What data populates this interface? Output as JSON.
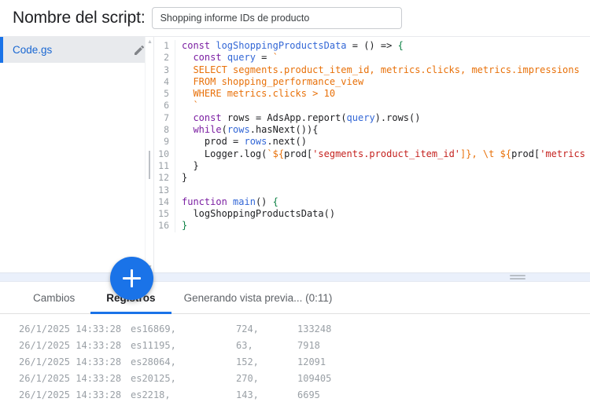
{
  "header": {
    "label": "Nombre del script:",
    "script_name": "Shopping informe IDs de producto",
    "placeholder": "Nombre del script"
  },
  "sidebar": {
    "files": [
      {
        "name": "Code.gs",
        "edit_icon": "pencil-icon",
        "active": true
      }
    ],
    "add_button_icon": "plus-icon",
    "scroll_up_icon": "caret-up-icon",
    "scroll_down_icon": "caret-down-icon"
  },
  "editor": {
    "lines": [
      {
        "n": "1",
        "tokens": [
          {
            "t": "const ",
            "c": "kw"
          },
          {
            "t": "logShoppingProductsData",
            "c": "fn"
          },
          {
            "t": " = () => ",
            "c": "plain"
          },
          {
            "t": "{",
            "c": "brc"
          }
        ]
      },
      {
        "n": "2",
        "tokens": [
          {
            "t": "  ",
            "c": "plain"
          },
          {
            "t": "const ",
            "c": "kw"
          },
          {
            "t": "query",
            "c": "var"
          },
          {
            "t": " = ",
            "c": "plain"
          },
          {
            "t": "`",
            "c": "sql"
          }
        ]
      },
      {
        "n": "3",
        "tokens": [
          {
            "t": "  SELECT segments.product_item_id, metrics.clicks, metrics.impressions",
            "c": "sql"
          }
        ]
      },
      {
        "n": "4",
        "tokens": [
          {
            "t": "  FROM shopping_performance_view",
            "c": "sql"
          }
        ]
      },
      {
        "n": "5",
        "tokens": [
          {
            "t": "  WHERE metrics.clicks > 10",
            "c": "sql"
          }
        ]
      },
      {
        "n": "6",
        "tokens": [
          {
            "t": "  `",
            "c": "sql"
          }
        ]
      },
      {
        "n": "7",
        "tokens": [
          {
            "t": "  ",
            "c": "plain"
          },
          {
            "t": "const ",
            "c": "kw"
          },
          {
            "t": "rows",
            "c": "plain"
          },
          {
            "t": " = AdsApp.report(",
            "c": "plain"
          },
          {
            "t": "query",
            "c": "var"
          },
          {
            "t": ").rows()",
            "c": "plain"
          }
        ]
      },
      {
        "n": "8",
        "tokens": [
          {
            "t": "  ",
            "c": "plain"
          },
          {
            "t": "while",
            "c": "kw"
          },
          {
            "t": "(",
            "c": "plain"
          },
          {
            "t": "rows",
            "c": "var"
          },
          {
            "t": ".hasNext()){",
            "c": "plain"
          }
        ]
      },
      {
        "n": "9",
        "tokens": [
          {
            "t": "    prod = ",
            "c": "plain"
          },
          {
            "t": "rows",
            "c": "var"
          },
          {
            "t": ".next()",
            "c": "plain"
          }
        ]
      },
      {
        "n": "10",
        "tokens": [
          {
            "t": "    Logger.log(",
            "c": "plain"
          },
          {
            "t": "`",
            "c": "tpl"
          },
          {
            "t": "${",
            "c": "tpl"
          },
          {
            "t": "prod[",
            "c": "plain"
          },
          {
            "t": "'segments.product_item_id'",
            "c": "str"
          },
          {
            "t": "]}",
            "c": "tpl"
          },
          {
            "t": ", \\t ",
            "c": "tpl"
          },
          {
            "t": "${",
            "c": "tpl"
          },
          {
            "t": "prod[",
            "c": "plain"
          },
          {
            "t": "'metrics",
            "c": "str"
          }
        ]
      },
      {
        "n": "11",
        "tokens": [
          {
            "t": "  }",
            "c": "plain"
          }
        ]
      },
      {
        "n": "12",
        "tokens": [
          {
            "t": "}",
            "c": "plain"
          }
        ]
      },
      {
        "n": "13",
        "tokens": [
          {
            "t": "",
            "c": "plain"
          }
        ]
      },
      {
        "n": "14",
        "tokens": [
          {
            "t": "function ",
            "c": "kw"
          },
          {
            "t": "main",
            "c": "fn"
          },
          {
            "t": "() ",
            "c": "plain"
          },
          {
            "t": "{",
            "c": "brc"
          }
        ]
      },
      {
        "n": "15",
        "tokens": [
          {
            "t": "  logShoppingProductsData()",
            "c": "plain"
          }
        ]
      },
      {
        "n": "16",
        "tokens": [
          {
            "t": "}",
            "c": "brc"
          }
        ]
      }
    ]
  },
  "bottom_panel": {
    "resize_handle_icon": "drag-handle-icon",
    "tabs": [
      {
        "label": "Cambios",
        "active": false
      },
      {
        "label": "Registros",
        "active": true
      },
      {
        "label": "Generando vista previa... (0:11)",
        "active": false
      }
    ],
    "logs": [
      {
        "timestamp": "26/1/2025 14:33:28",
        "product_id": "es16869,",
        "clicks": "724,",
        "impressions": "133248"
      },
      {
        "timestamp": "26/1/2025 14:33:28",
        "product_id": "es11195,",
        "clicks": "63,",
        "impressions": "7918"
      },
      {
        "timestamp": "26/1/2025 14:33:28",
        "product_id": "es28064,",
        "clicks": "152,",
        "impressions": "12091"
      },
      {
        "timestamp": "26/1/2025 14:33:28",
        "product_id": "es20125,",
        "clicks": "270,",
        "impressions": "109405"
      },
      {
        "timestamp": "26/1/2025 14:33:28",
        "product_id": "es2218,",
        "clicks": "143,",
        "impressions": "6695"
      }
    ]
  },
  "colors": {
    "accent": "#1a73e8",
    "file_active_bg": "#e8eaed",
    "log_text": "#9aa0a6"
  }
}
